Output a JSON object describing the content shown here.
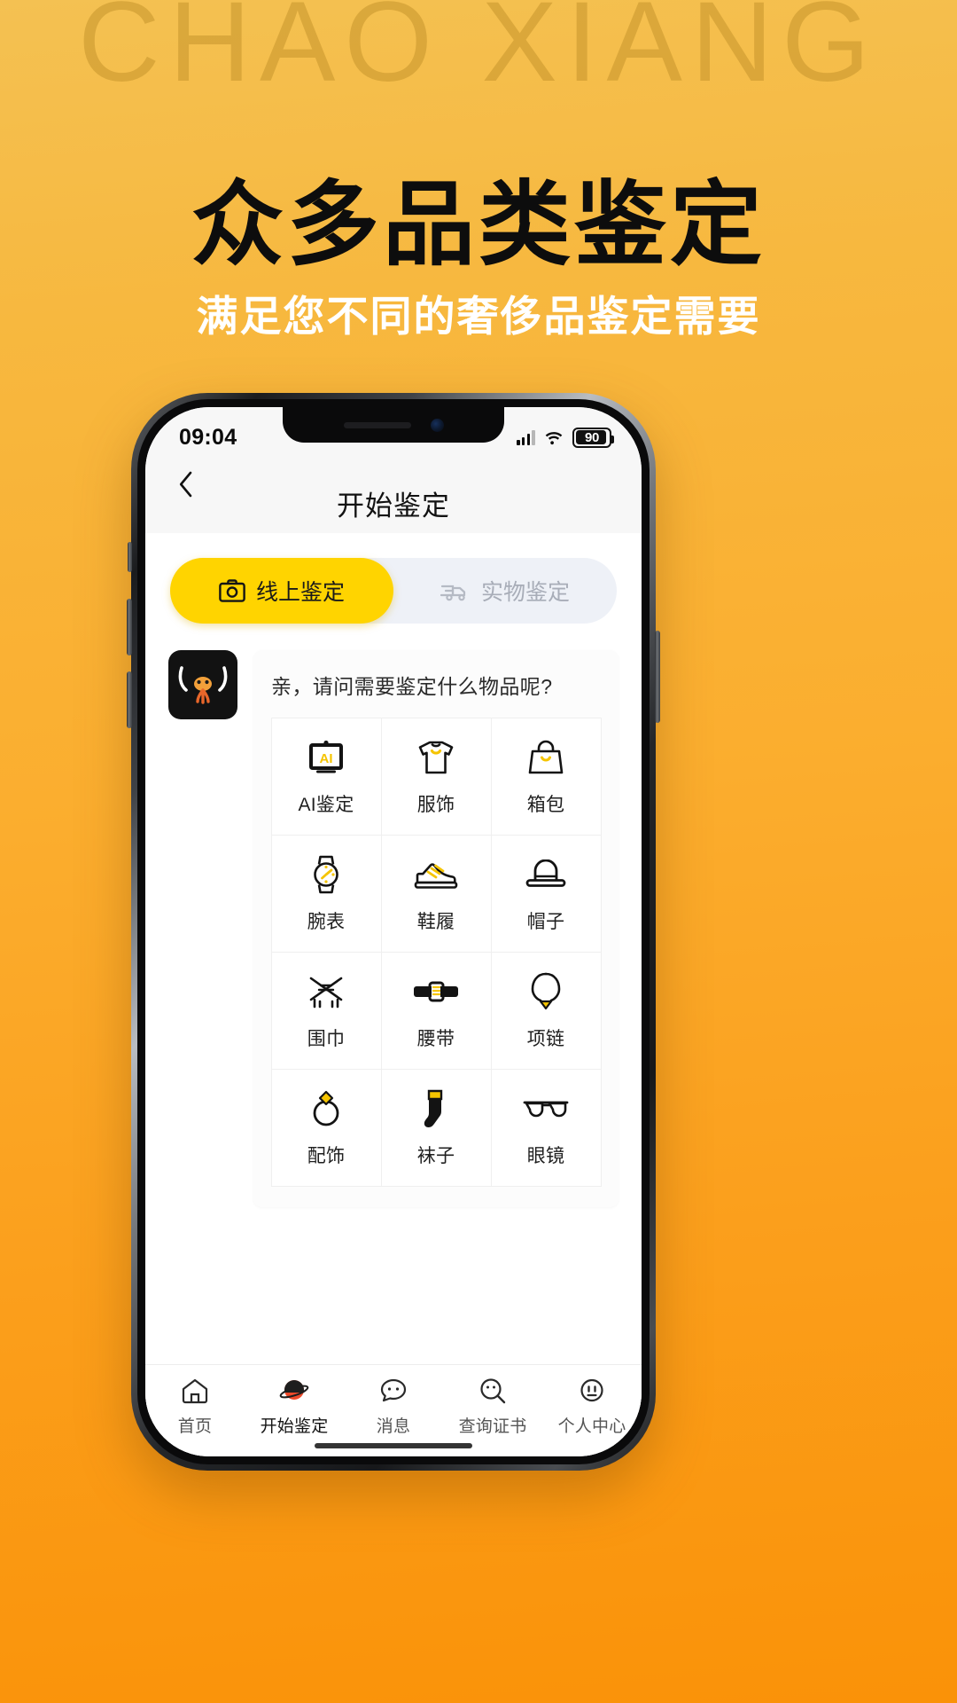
{
  "promo": {
    "watermark": "CHAO XIANG",
    "headline": "众多品类鉴定",
    "subhead": "满足您不同的奢侈品鉴定需要"
  },
  "colors": {
    "bg_top": "#f4c152",
    "bg_bottom": "#fa9208",
    "accent": "#ffd400",
    "watermark": "#c4932c",
    "segment_inactive_bg": "#eef1f7",
    "segment_inactive_text": "#a8adb8"
  },
  "status_bar": {
    "time": "09:04",
    "signal_icon": "cellular-signal-icon",
    "wifi_icon": "wifi-icon",
    "battery_icon": "battery-icon",
    "battery_level": "90"
  },
  "nav": {
    "back_icon": "chevron-left-icon",
    "title": "开始鉴定"
  },
  "segments": [
    {
      "label": "线上鉴定",
      "icon": "camera-icon",
      "active": true
    },
    {
      "label": "实物鉴定",
      "icon": "truck-icon",
      "active": false
    }
  ],
  "chat": {
    "avatar_icon": "mascot-avatar-icon",
    "question": "亲，请问需要鉴定什么物品呢?"
  },
  "categories": [
    {
      "label": "AI鉴定",
      "icon": "ai-board-icon"
    },
    {
      "label": "服饰",
      "icon": "tshirt-icon"
    },
    {
      "label": "箱包",
      "icon": "handbag-icon"
    },
    {
      "label": "腕表",
      "icon": "watch-icon"
    },
    {
      "label": "鞋履",
      "icon": "sneaker-icon"
    },
    {
      "label": "帽子",
      "icon": "hat-icon"
    },
    {
      "label": "围巾",
      "icon": "scarf-icon"
    },
    {
      "label": "腰带",
      "icon": "belt-icon"
    },
    {
      "label": "项链",
      "icon": "necklace-icon"
    },
    {
      "label": "配饰",
      "icon": "ring-icon"
    },
    {
      "label": "袜子",
      "icon": "sock-icon"
    },
    {
      "label": "眼镜",
      "icon": "glasses-icon"
    }
  ],
  "tabbar": [
    {
      "label": "首页",
      "icon": "home-icon",
      "active": false
    },
    {
      "label": "开始鉴定",
      "icon": "appraisal-icon",
      "active": true
    },
    {
      "label": "消息",
      "icon": "message-icon",
      "active": false
    },
    {
      "label": "查询证书",
      "icon": "certificate-icon",
      "active": false
    },
    {
      "label": "个人中心",
      "icon": "profile-icon",
      "active": false
    }
  ]
}
